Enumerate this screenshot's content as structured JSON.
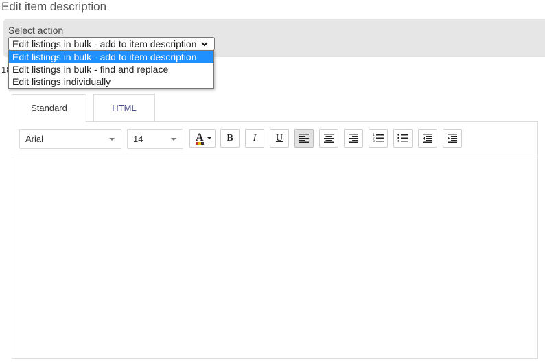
{
  "page": {
    "title": "Edit item description"
  },
  "action": {
    "label": "Select action",
    "selected": "Edit listings in bulk - add to item description",
    "options": [
      "Edit listings in bulk - add to item description",
      "Edit listings in bulk - find and replace",
      "Edit listings individually"
    ],
    "partial_hidden_text": "18"
  },
  "tabs": [
    {
      "label": "Standard"
    },
    {
      "label": "HTML"
    }
  ],
  "toolbar": {
    "font": "Arial",
    "size": "14",
    "buttons": [
      "text-color-icon",
      "bold-icon",
      "italic-icon",
      "underline-icon",
      "align-left-icon",
      "align-center-icon",
      "align-right-icon",
      "ordered-list-icon",
      "unordered-list-icon",
      "outdent-icon",
      "indent-icon"
    ],
    "bold_label": "B",
    "italic_label": "I",
    "underline_label": "U"
  },
  "colors": {
    "panel": "#e6e6e6",
    "selected_option": "#1e90ff",
    "html_tab_text": "#4a4a8a"
  }
}
